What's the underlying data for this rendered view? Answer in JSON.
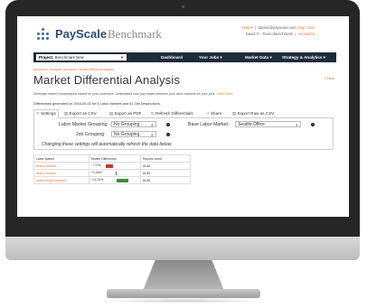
{
  "app": {
    "logo_name": "PayScale",
    "logo_sub": "Benchmark",
    "user_help": "Help ▾",
    "user_email": "davido@payscale.com",
    "user_signout": "(Sign Out)",
    "user_company": "David O · Demo Benchmark",
    "user_account": "Account ▾"
  },
  "nav": {
    "project_label": "Project:",
    "project_value": "Benchmark New",
    "items": [
      "Dashboard",
      "Your Jobs ▾",
      "Market Data ▾",
      "Strategy & Analytics ▾"
    ]
  },
  "page": {
    "breadcrumb": "Dashboard › Analytics Launchpad › Market Differential Analysis",
    "title": "Market Differential Analysis",
    "help": "? Help",
    "description": "Generate market comparisons based on your workforce. Understand how pay varies between your labor markets for your jobs.",
    "description_link": "Learn More",
    "generated": "Differentials generated on 2016-06-02 for 4 Labor Markets and 81 Job Descriptions."
  },
  "tabs": [
    "Settings",
    "Export as CSV",
    "Export as PDF",
    "Refresh Differentials",
    "Share",
    "Export Raw as CSV"
  ],
  "settings": {
    "labor_market_grouping_label": "Labor Market Grouping:",
    "labor_market_grouping_value": "No Grouping",
    "job_grouping_label": "Job Grouping:",
    "job_grouping_value": "No Grouping",
    "base_labor_market_label": "Base Labor Market:",
    "base_labor_market_value": "Seattle Office",
    "note": "Changing these settings will automatically refresh the data below."
  },
  "table": {
    "headers": [
      "Labor Market",
      "Market Differential",
      "Reports Used"
    ],
    "rows": [
      {
        "market": "Branch Atlanta",
        "diff": "-7.72%",
        "diff_value": -7.72,
        "reports": "81/81",
        "color": "#c0392b"
      },
      {
        "market": "Branch Boston",
        "diff": "+1.06%",
        "diff_value": 1.06,
        "reports": "81/81",
        "color": "#3b8c3b"
      },
      {
        "market": "Branch San Francisco",
        "diff": "+11.31%",
        "diff_value": 11.31,
        "reports": "81/81",
        "color": "#3b8c3b"
      }
    ]
  }
}
